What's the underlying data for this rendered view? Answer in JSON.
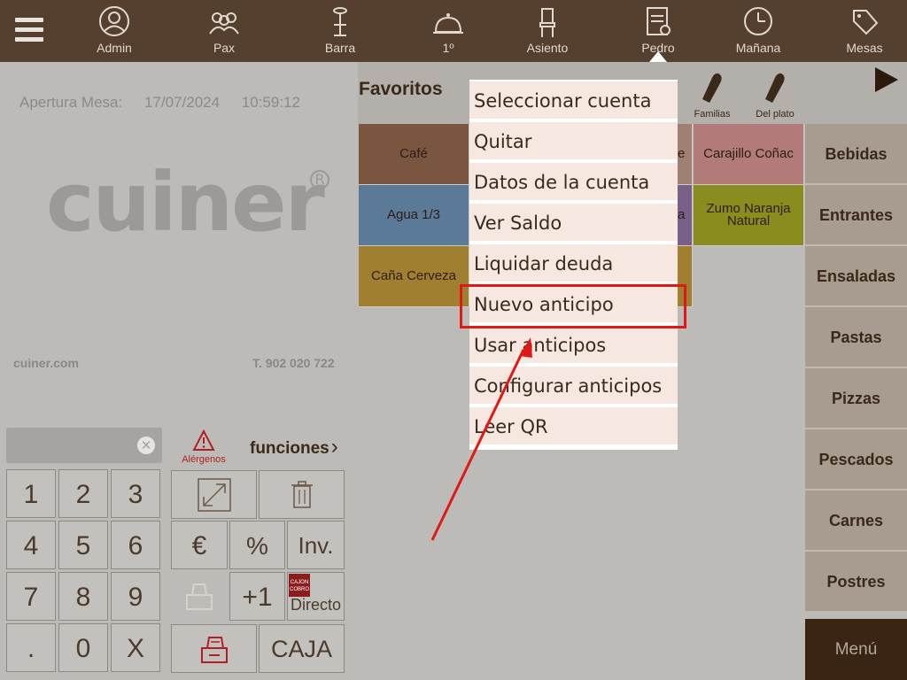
{
  "topbar": {
    "items": [
      {
        "label": "Admin",
        "icon": "user-icon"
      },
      {
        "label": "Pax",
        "icon": "people-icon"
      },
      {
        "label": "Barra",
        "icon": "bar-stool-icon"
      },
      {
        "label": "1º",
        "icon": "cloche-icon"
      },
      {
        "label": "Asiento",
        "icon": "chair-icon"
      },
      {
        "label": "Pedro",
        "icon": "waiter-document-icon"
      },
      {
        "label": "Mañana",
        "icon": "clock-icon"
      },
      {
        "label": "Mesas",
        "icon": "tags-icon"
      }
    ]
  },
  "left": {
    "apertura_label": "Apertura Mesa:",
    "date": "17/07/2024",
    "time": "10:59:12",
    "logo": "cuiner",
    "logo_reg": "R",
    "site": "cuiner.com",
    "phone": "T. 902 020 722"
  },
  "keypad": {
    "keys": [
      "1",
      "2",
      "3",
      "4",
      "5",
      "6",
      "7",
      "8",
      "9",
      ".",
      "0",
      "X"
    ],
    "clear": "✕"
  },
  "functions": {
    "alergenos": "Alérgenos",
    "funciones": "funciones",
    "euro": "€",
    "percent": "%",
    "inv": "Inv.",
    "plus_one": "+1",
    "directo": "Directo",
    "cajon_label_1": "CAJON",
    "cajon_label_2": "COBRO",
    "caja": "CAJA"
  },
  "favorites": {
    "title": "Favoritos",
    "header_icons": [
      {
        "label": "Familias",
        "icon": "salt-shaker-icon"
      },
      {
        "label": "Del plato",
        "icon": "salt-shaker-icon"
      }
    ],
    "tiles": [
      {
        "label": "Café",
        "color": "#7a5540"
      },
      {
        "label": "e",
        "color": "#a08070"
      },
      {
        "label": "Carajillo Coñac",
        "color": "#b27a78"
      },
      {
        "label": "Agua 1/3",
        "color": "#5a7a98"
      },
      {
        "label": "a",
        "color": "#7a6088"
      },
      {
        "label": "Zumo Naranja Natural",
        "color": "#8a8c1e"
      },
      {
        "label": "Caña Cerveza",
        "color": "#a08030"
      },
      {
        "label": "",
        "color": "#a08030"
      }
    ]
  },
  "categories": [
    "Bebidas",
    "Entrantes",
    "Ensaladas",
    "Pastas",
    "Pizzas",
    "Pescados",
    "Carnes",
    "Postres"
  ],
  "menu_button": "Menú",
  "dropdown": {
    "items": [
      "Seleccionar cuenta",
      "Quitar",
      "Datos de la cuenta",
      "Ver Saldo",
      "Liquidar deuda",
      "Nuevo anticipo",
      "Usar anticipos",
      "Configurar anticipos",
      "Leer QR"
    ],
    "highlighted": "Nuevo anticipo"
  },
  "colors": {
    "topbar": "#55402f",
    "overlay_bg": "#bdbbb8",
    "dropdown_item": "#f6e8e0",
    "highlight": "#e01818"
  }
}
